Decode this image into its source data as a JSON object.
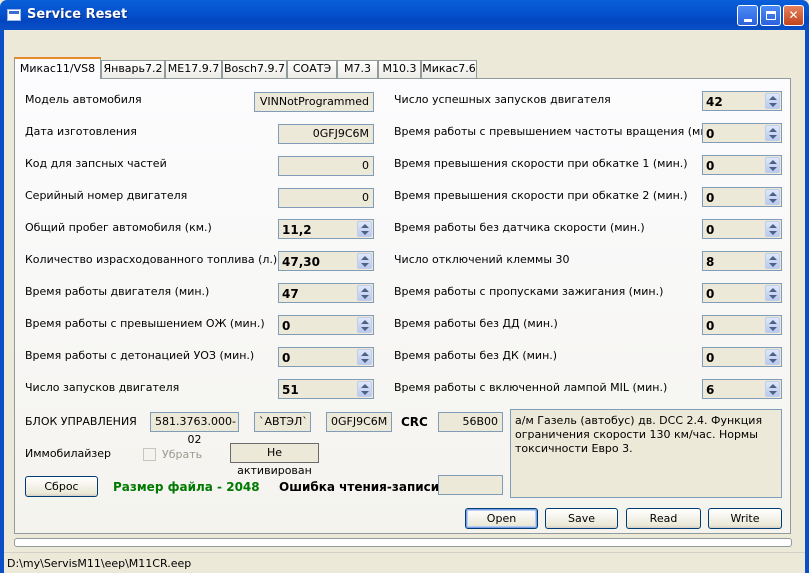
{
  "window": {
    "title": "Service Reset"
  },
  "tabs": [
    "Микас11/VS8",
    "Январь7.2",
    "ME17.9.7",
    "Bosch7.9.7",
    "СОАТЭ",
    "M7.3",
    "M10.3",
    "Микас7.6"
  ],
  "left": {
    "model_label": "Модель автомобиля",
    "model_value": "VINNotProgrammed",
    "date_label": "Дата изготовления",
    "date_value": "0GFJ9C6M",
    "parts_label": "Код для запсных частей",
    "parts_value": "0",
    "serial_label": "Серийный номер двигателя",
    "serial_value": "0",
    "mileage_label": "Общий пробег автомобиля  (км.)",
    "mileage_value": "11,2",
    "fuel_label": "Количество израсходованного топлива (л.)",
    "fuel_value": "47,30",
    "engine_time_label": "Время работы двигателя (мин.)",
    "engine_time_value": "47",
    "coolant_label": "Время работы с превышением ОЖ (мин.)",
    "coolant_value": "0",
    "detonation_label": "Время работы с детонацией УОЗ (мин.)",
    "detonation_value": "0",
    "starts_label": "Число запусков двигателя",
    "starts_value": "51"
  },
  "right": {
    "succ_starts_label": "Число успешных запусков двигателя",
    "succ_starts_value": "42",
    "rpm_over_label": "Время работы с превышением частоты вращения (мин.)",
    "rpm_over_value": "0",
    "speed1_label": "Время превышения скорости при обкатке 1 (мин.)",
    "speed1_value": "0",
    "speed2_label": "Время превышения скорости при обкатке 2 (мин.)",
    "speed2_value": "0",
    "no_speed_label": "Время работы без датчика скорости (мин.)",
    "no_speed_value": "0",
    "term30_label": "Число отключений клеммы 30",
    "term30_value": "8",
    "misfire_label": "Время работы с пропусками зажигания (мин.)",
    "misfire_value": "0",
    "no_dd_label": "Время работы без ДД (мин.)",
    "no_dd_value": "0",
    "no_dk_label": "Время работы без ДК (мин.)",
    "no_dk_value": "0",
    "mil_label": "Время работы с включенной лампой MIL (мин.)",
    "mil_value": "6"
  },
  "ecu": {
    "label": "БЛОК УПРАВЛЕНИЯ",
    "number": "581.3763.000-02",
    "vendor": "`АВТЭЛ`",
    "id": "0GFJ9C6M",
    "crc_label": "CRC",
    "crc_value": "56B00",
    "description": "а/м Газель (автобус) дв. DCC 2.4. Функция ограничения скорости 130 км/час. Нормы токсичности Евро 3."
  },
  "immo": {
    "label": "Иммобилайзер",
    "checkbox_label": "Убрать",
    "status": "Не активирован"
  },
  "footer": {
    "reset_button": "Сброс",
    "file_size_label": "Размер файла  -  2048",
    "error_label": "Ошибка чтения-записи",
    "error_value": "",
    "open_button": "Open",
    "save_button": "Save",
    "read_button": "Read",
    "write_button": "Write"
  },
  "status_bar": {
    "path": "D:\\my\\ServisM11\\eep\\M11CR.eep"
  },
  "colors": {
    "titlebar": "#0553d0",
    "file_size_text": "#007a00"
  }
}
